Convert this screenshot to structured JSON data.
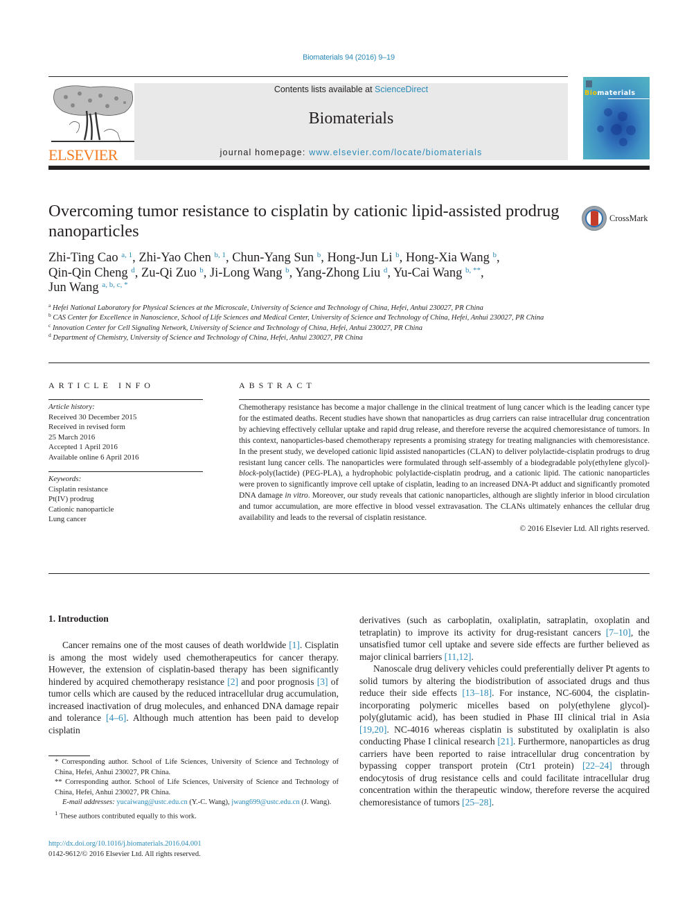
{
  "header": {
    "journal_ref": "Biomaterials 94 (2016) 9–19",
    "contents_prefix": "Contents lists available at ",
    "contents_link": "ScienceDirect",
    "journal_name": "Biomaterials",
    "homepage_prefix": "journal homepage: ",
    "homepage_link": "www.elsevier.com/locate/biomaterials",
    "publisher_logo_text": "ELSEVIER",
    "cover_title_highlight": "Bio",
    "cover_title_rest": "materials",
    "accent_color": "#2a8ab8",
    "publisher_color": "#f47b20"
  },
  "crossmark": {
    "label": "CrossMark"
  },
  "article": {
    "title": "Overcoming tumor resistance to cisplatin by cationic lipid-assisted prodrug nanoparticles",
    "authors": [
      {
        "name": "Zhi-Ting Cao",
        "sup": "a, 1",
        "sep": ", "
      },
      {
        "name": "Zhi-Yao Chen",
        "sup": "b, 1",
        "sep": ", "
      },
      {
        "name": "Chun-Yang Sun",
        "sup": "b",
        "sep": ", "
      },
      {
        "name": "Hong-Jun Li",
        "sup": "b",
        "sep": ", "
      },
      {
        "name": "Hong-Xia Wang",
        "sup": "b",
        "sep": ", "
      },
      {
        "name": "Qin-Qin Cheng",
        "sup": "d",
        "sep": ", "
      },
      {
        "name": "Zu-Qi Zuo",
        "sup": "b",
        "sep": ", "
      },
      {
        "name": "Ji-Long Wang",
        "sup": "b",
        "sep": ", "
      },
      {
        "name": "Yang-Zhong Liu",
        "sup": "d",
        "sep": ", "
      },
      {
        "name": "Yu-Cai Wang",
        "sup": "b, **",
        "sep": ", "
      },
      {
        "name": "Jun Wang",
        "sup": "a, b, c, *",
        "sep": ""
      }
    ],
    "affiliations": [
      {
        "key": "a",
        "text": "Hefei National Laboratory for Physical Sciences at the Microscale, University of Science and Technology of China, Hefei, Anhui 230027, PR China"
      },
      {
        "key": "b",
        "text": "CAS Center for Excellence in Nanoscience, School of Life Sciences and Medical Center, University of Science and Technology of China, Hefei, Anhui 230027, PR China"
      },
      {
        "key": "c",
        "text": "Innovation Center for Cell Signaling Network, University of Science and Technology of China, Hefei, Anhui 230027, PR China"
      },
      {
        "key": "d",
        "text": "Department of Chemistry, University of Science and Technology of China, Hefei, Anhui 230027, PR China"
      }
    ]
  },
  "article_info": {
    "heading": "ARTICLE INFO",
    "history_label": "Article history:",
    "history": [
      "Received 30 December 2015",
      "Received in revised form",
      "25 March 2016",
      "Accepted 1 April 2016",
      "Available online 6 April 2016"
    ],
    "keywords_label": "Keywords:",
    "keywords": [
      "Cisplatin resistance",
      "Pt(IV) prodrug",
      "Cationic nanoparticle",
      "Lung cancer"
    ]
  },
  "abstract": {
    "heading": "ABSTRACT",
    "part1": "Chemotherapy resistance has become a major challenge in the clinical treatment of lung cancer which is the leading cancer type for the estimated deaths. Recent studies have shown that nanoparticles as drug carriers can raise intracellular drug concentration by achieving effectively cellular uptake and rapid drug release, and therefore reverse the acquired chemoresistance of tumors. In this context, nanoparticles-based chemotherapy represents a promising strategy for treating malignancies with chemoresistance. In the present study, we developed cationic lipid assisted nanoparticles (CLAN) to deliver polylactide-cisplatin prodrugs to drug resistant lung cancer cells. The nanoparticles were formulated through self-assembly of a biodegradable poly(ethylene glycol)-",
    "italic1": "block",
    "part2": "-poly(lactide) (PEG-PLA), a hydrophobic polylactide-cisplatin prodrug, and a cationic lipid. The cationic nanoparticles were proven to significantly improve cell uptake of cisplatin, leading to an increased DNA-Pt adduct and significantly promoted DNA damage ",
    "italic2": "in vitro",
    "part3": ". Moreover, our study reveals that cationic nanoparticles, although are slightly inferior in blood circulation and tumor accumulation, are more effective in blood vessel extravasation. The CLANs ultimately enhances the cellular drug availability and leads to the reversal of cisplatin resistance.",
    "copyright": "© 2016 Elsevier Ltd. All rights reserved."
  },
  "introduction": {
    "heading": "1.  Introduction",
    "left": [
      {
        "t": "Cancer remains one of the most causes of death worldwide "
      },
      {
        "r": "[1]"
      },
      {
        "t": ". Cisplatin is among the most widely used chemotherapeutics for cancer therapy. However, the extension of cisplatin-based therapy has been significantly hindered by acquired chemotherapy resistance "
      },
      {
        "r": "[2]"
      },
      {
        "t": " and poor prognosis "
      },
      {
        "r": "[3]"
      },
      {
        "t": " of tumor cells which are caused by the reduced intracellular drug accumulation, increased inactivation of drug molecules, and enhanced DNA damage repair and tolerance "
      },
      {
        "r": "[4–6]"
      },
      {
        "t": ". Although much attention has been paid to develop cisplatin"
      }
    ],
    "right_p1": [
      {
        "t": "derivatives (such as carboplatin, oxaliplatin, satraplatin, oxoplatin and tetraplatin) to improve its activity for drug-resistant cancers "
      },
      {
        "r": "[7–10]"
      },
      {
        "t": ", the unsatisfied tumor cell uptake and severe side effects are further believed as major clinical barriers "
      },
      {
        "r": "[11,12]"
      },
      {
        "t": "."
      }
    ],
    "right_p2": [
      {
        "t": "Nanoscale drug delivery vehicles could preferentially deliver Pt agents to solid tumors by altering the biodistribution of associated drugs and thus reduce their side effects "
      },
      {
        "r": "[13–18]"
      },
      {
        "t": ". For instance, NC-6004, the cisplatin-incorporating polymeric micelles based on poly(ethylene glycol)-poly(glutamic acid), has been studied in Phase III clinical trial in Asia "
      },
      {
        "r": "[19,20]"
      },
      {
        "t": ". NC-4016 whereas cisplatin is substituted by oxaliplatin is also conducting Phase I clinical research "
      },
      {
        "r": "[21]"
      },
      {
        "t": ". Furthermore, nanoparticles as drug carriers have been reported to raise intracellular drug concentration by bypassing copper transport protein (Ctr1 protein) "
      },
      {
        "r": "[22–24]"
      },
      {
        "t": " through endocytosis of drug resistance cells and could facilitate intracellular drug concentration within the therapeutic window, therefore reverse the acquired chemoresistance of tumors "
      },
      {
        "r": "[25–28]"
      },
      {
        "t": "."
      }
    ]
  },
  "footnotes": {
    "fn1_mark": "*",
    "fn1": "Corresponding author. School of Life Sciences, University of Science and Technology of China, Hefei, Anhui 230027, PR China.",
    "fn2_mark": "**",
    "fn2": "Corresponding author. School of Life Sciences, University of Science and Technology of China, Hefei, Anhui 230027, PR China.",
    "email_label": "E-mail addresses:",
    "email1": "yucaiwang@ustc.edu.cn",
    "email1_owner": " (Y.-C. Wang), ",
    "email2": "jwang699@ustc.edu.cn",
    "email2_owner": " (J. Wang).",
    "fn3_mark": "1",
    "fn3": "These authors contributed equally to this work."
  },
  "doi": {
    "link": "http://dx.doi.org/10.1016/j.biomaterials.2016.04.001",
    "rights": "0142-9612/© 2016 Elsevier Ltd. All rights reserved."
  }
}
